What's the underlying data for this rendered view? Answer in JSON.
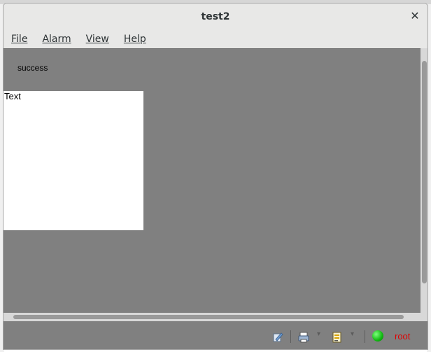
{
  "window": {
    "title": "test2"
  },
  "menu": {
    "items": [
      {
        "label": "File"
      },
      {
        "label": "Alarm"
      },
      {
        "label": "View"
      },
      {
        "label": "Help"
      }
    ]
  },
  "content": {
    "status_text": "success",
    "text_box": "Text"
  },
  "statusbar": {
    "icons": [
      "edit-icon",
      "printer-icon",
      "notes-icon",
      "status-led-icon"
    ],
    "user": "root",
    "colors": {
      "led": "#10b810",
      "user": "#e00000"
    }
  }
}
